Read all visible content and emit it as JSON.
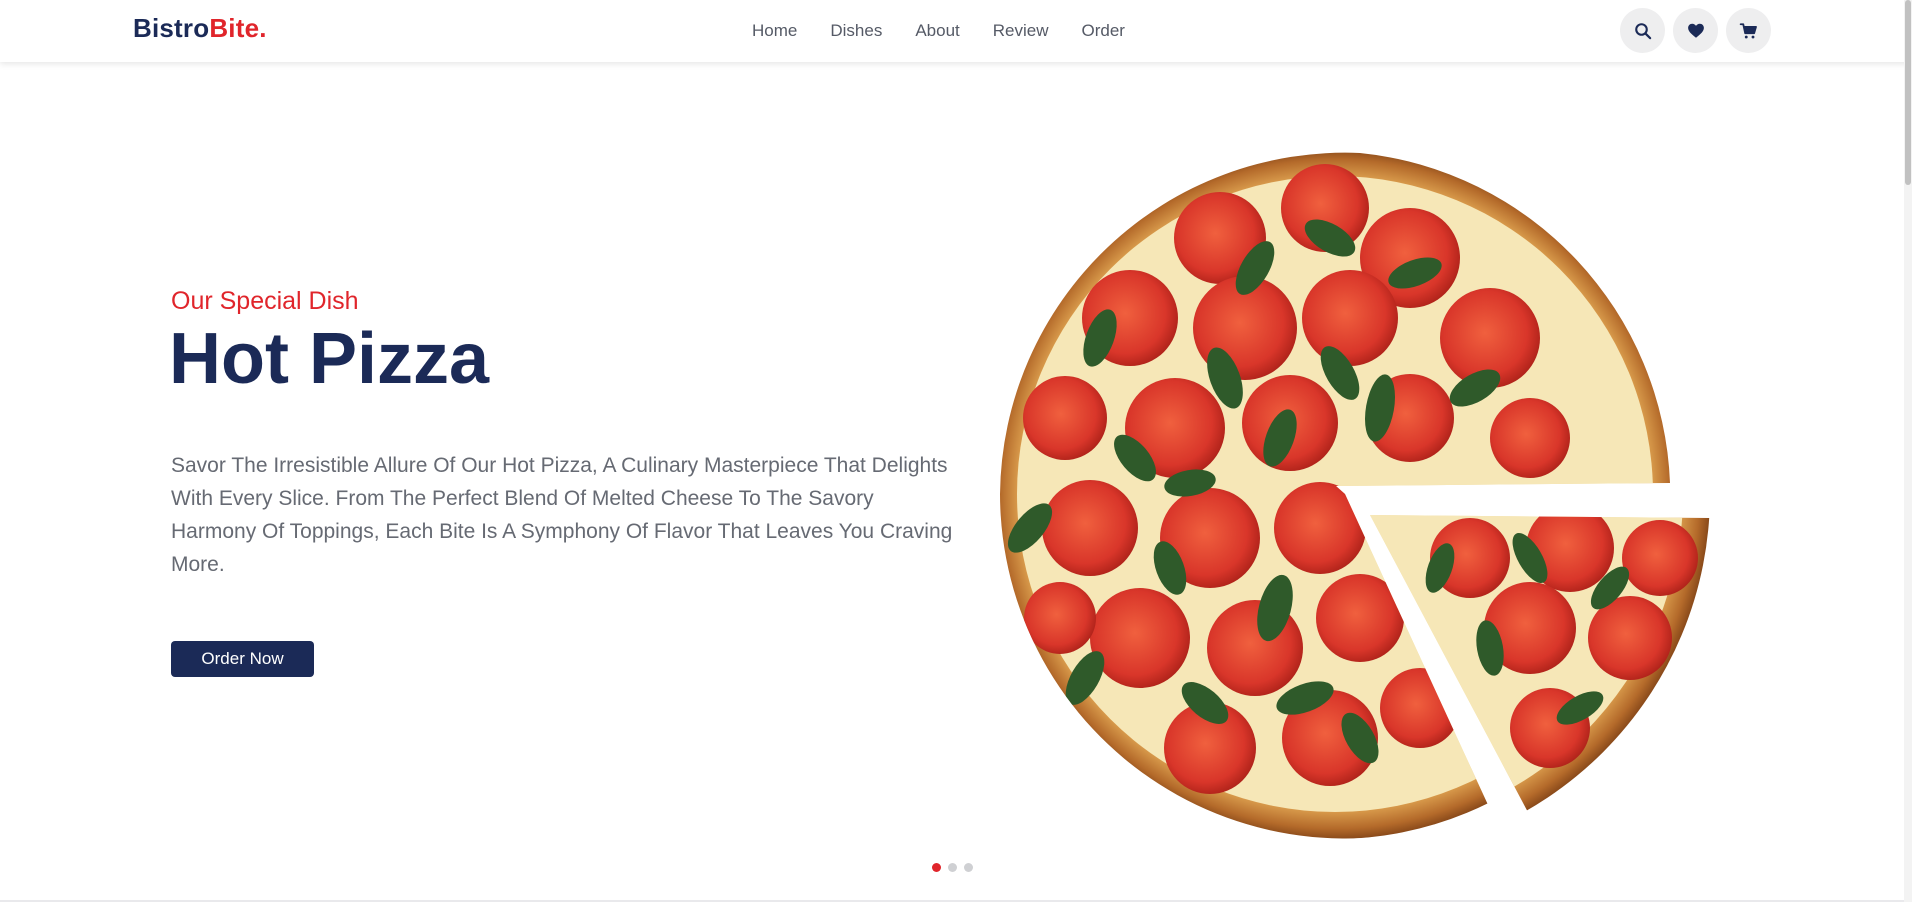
{
  "brand": {
    "name_main": "Bistro",
    "name_accent": "Bite."
  },
  "nav": {
    "items": [
      "Home",
      "Dishes",
      "About",
      "Review",
      "Order"
    ]
  },
  "header_icons": [
    "search-icon",
    "heart-icon",
    "cart-icon"
  ],
  "hero": {
    "subtitle": "Our Special Dish",
    "title": "Hot Pizza",
    "description": "Savor The Irresistible Allure Of Our Hot Pizza, A Culinary Masterpiece That Delights With Every Slice. From The Perfect Blend Of Melted Cheese To The Savory Harmony Of Toppings, Each Bite Is A Symphony Of Flavor That Leaves You Craving More.",
    "button_label": "Order Now",
    "slides_total": 3,
    "active_slide": 1
  },
  "colors": {
    "primary": "#1b2a57",
    "accent": "#e0252b",
    "text_muted": "#666a73"
  }
}
